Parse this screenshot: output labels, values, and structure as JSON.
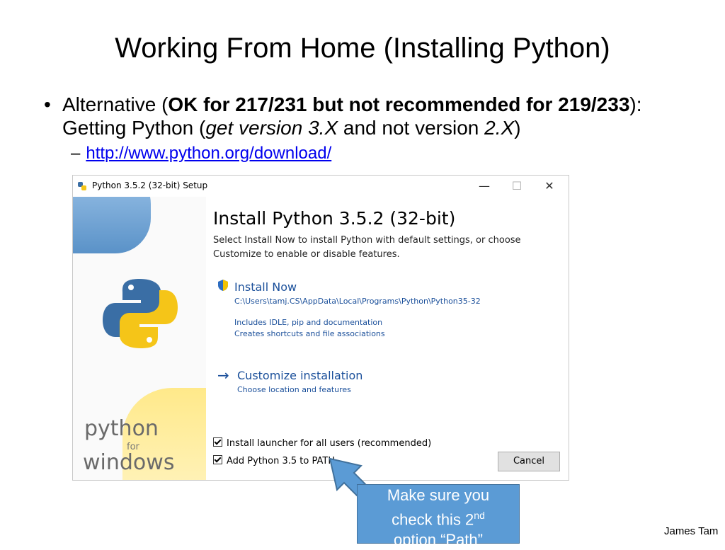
{
  "slide": {
    "title": "Working From Home (Installing Python)",
    "bullet": {
      "text1": "Alternative (",
      "bold": "OK for 217/231 but not recommended for 219/233",
      "text2": "): Getting Python (",
      "italic1": "get version 3.X",
      "text3": " and not version ",
      "italic2": "2.X",
      "text4": ")"
    },
    "link": "http://www.python.org/download/",
    "footer": "James Tam"
  },
  "installer": {
    "window_title": "Python 3.5.2 (32-bit) Setup",
    "heading": "Install Python 3.5.2 (32-bit)",
    "description": "Select Install Now to install Python with default settings, or choose Customize to enable or disable features.",
    "install_now": "Install Now",
    "install_path": "C:\\Users\\tamj.CS\\AppData\\Local\\Programs\\Python\\Python35-32",
    "includes_line1": "Includes IDLE, pip and documentation",
    "includes_line2": "Creates shortcuts and file associations",
    "customize": "Customize installation",
    "customize_desc": "Choose location and features",
    "checkbox1": "Install launcher for all users (recommended)",
    "checkbox2": "Add Python 3.5 to PATH",
    "cancel": "Cancel",
    "logo_word1": "python",
    "logo_for": "for",
    "logo_word2": "windows"
  },
  "callout": {
    "line1": "Make sure you",
    "line2a": "check this 2",
    "line2sup": "nd",
    "line3": "option “Path”"
  },
  "colors": {
    "callout_fill": "#5b9bd5",
    "link": "#0000ee",
    "installer_accent": "#1a4f9a"
  }
}
